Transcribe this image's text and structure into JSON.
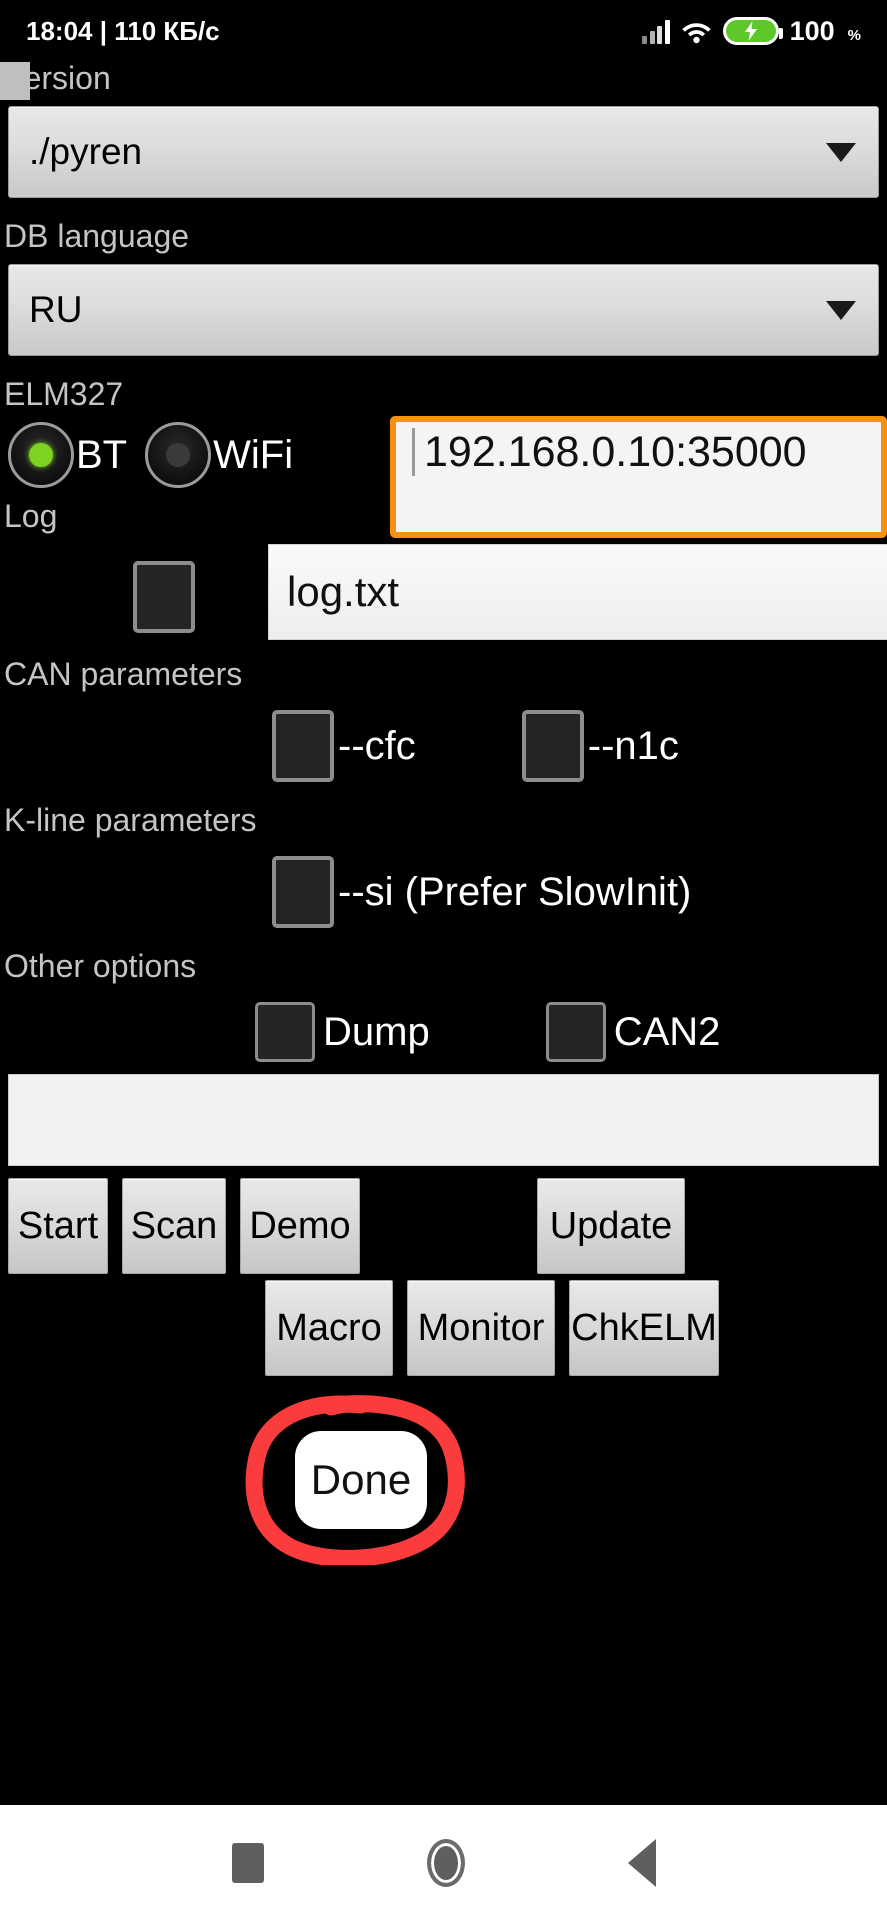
{
  "statusbar": {
    "time_and_speed": "18:04 | 110 КБ/с",
    "battery_percent": "100",
    "percent_symbol": "%",
    "icons": [
      "signal-icon",
      "wifi-icon",
      "battery-charging-icon"
    ]
  },
  "form": {
    "version": {
      "label": "Version",
      "value": "./pyren"
    },
    "db_language": {
      "label": "DB language",
      "value": "RU"
    },
    "elm327": {
      "label": "ELM327",
      "bt_label": "BT",
      "wifi_label": "WiFi",
      "selected": "BT",
      "address_value": "192.168.0.10:35000"
    },
    "log": {
      "label": "Log",
      "checked": false,
      "filename": "log.txt"
    },
    "can_parameters": {
      "label": "CAN parameters",
      "options": [
        {
          "label": "--cfc",
          "checked": false
        },
        {
          "label": "--n1c",
          "checked": false
        }
      ]
    },
    "kline_parameters": {
      "label": "K-line parameters",
      "options": [
        {
          "label": "--si (Prefer SlowInit)",
          "checked": false
        }
      ]
    },
    "other_options": {
      "label": "Other options",
      "options": [
        {
          "label": "Dump",
          "checked": false
        },
        {
          "label": "CAN2",
          "checked": false
        }
      ]
    },
    "console_value": ""
  },
  "buttons": {
    "row1": [
      "Start",
      "Scan",
      "Demo",
      "Update"
    ],
    "row2": [
      "Macro",
      "Monitor",
      "ChkELM"
    ]
  },
  "overlay": {
    "done_label": "Done",
    "annotation_color": "#fa3c3c",
    "demo_visible_text": "Dem"
  },
  "navbar": {
    "items": [
      "recents-square-icon",
      "home-circle-icon",
      "back-triangle-icon"
    ]
  },
  "colors": {
    "background": "#000000",
    "section_label": "#c4c4c4",
    "focus_border": "#f59112",
    "radio_on": "#7ed321",
    "battery_green": "#5ec82a"
  }
}
